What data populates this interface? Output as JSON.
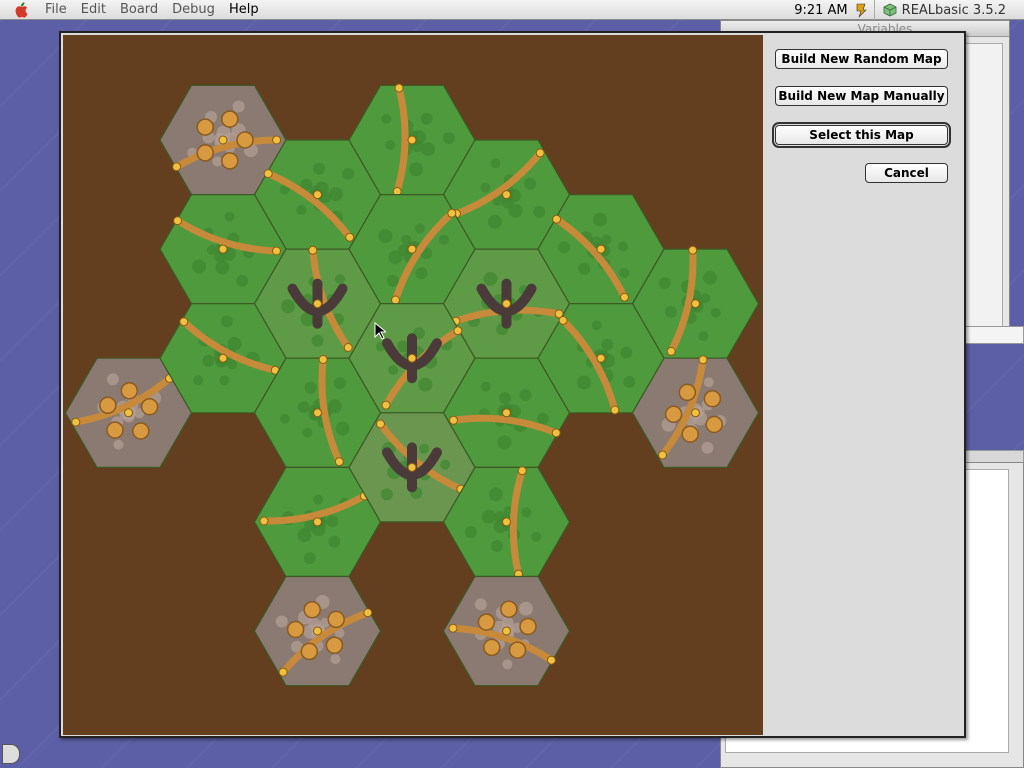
{
  "menubar": {
    "items": [
      "File",
      "Edit",
      "Board",
      "Debug",
      "Help"
    ],
    "clock": "9:21 AM",
    "app_name": "REALbasic 3.5.2"
  },
  "background_windows": {
    "variables_title": "Variables"
  },
  "dialog": {
    "buttons": {
      "random_map": "Build New Random Map",
      "manual_map": "Build New Map Manually",
      "select_map": "Select this Map",
      "cancel": "Cancel"
    }
  },
  "colors": {
    "desktop": "#5c5fa6",
    "map_background": "#633f1f",
    "forest": "#4f9a3c",
    "path": "#c68a3a",
    "rock": "#8a7a72"
  },
  "map": {
    "tiles": [
      {
        "col": 0,
        "row": 0,
        "type": "mountain"
      },
      {
        "col": 1,
        "row": 0,
        "type": "forest"
      },
      {
        "col": 2,
        "row": 0,
        "type": "forest"
      },
      {
        "col": 3,
        "row": 0,
        "type": "forest"
      },
      {
        "col": 0,
        "row": 1,
        "type": "forest"
      },
      {
        "col": 1,
        "row": 1,
        "type": "temple"
      },
      {
        "col": 2,
        "row": 1,
        "type": "forest"
      },
      {
        "col": 3,
        "row": 1,
        "type": "temple"
      },
      {
        "col": 4,
        "row": 1,
        "type": "forest"
      },
      {
        "col": 5,
        "row": 1,
        "type": "forest"
      },
      {
        "col": -1,
        "row": 2,
        "type": "mountain"
      },
      {
        "col": 0,
        "row": 2,
        "type": "forest"
      },
      {
        "col": 1,
        "row": 2,
        "type": "forest"
      },
      {
        "col": 2,
        "row": 2,
        "type": "temple"
      },
      {
        "col": 3,
        "row": 2,
        "type": "forest"
      },
      {
        "col": 4,
        "row": 2,
        "type": "forest"
      },
      {
        "col": 5,
        "row": 2,
        "type": "mountain"
      },
      {
        "col": 1,
        "row": 3,
        "type": "forest"
      },
      {
        "col": 2,
        "row": 3,
        "type": "ruins"
      },
      {
        "col": 3,
        "row": 3,
        "type": "forest"
      },
      {
        "col": 1,
        "row": 4,
        "type": "mountain"
      },
      {
        "col": 3,
        "row": 4,
        "type": "mountain"
      }
    ]
  }
}
